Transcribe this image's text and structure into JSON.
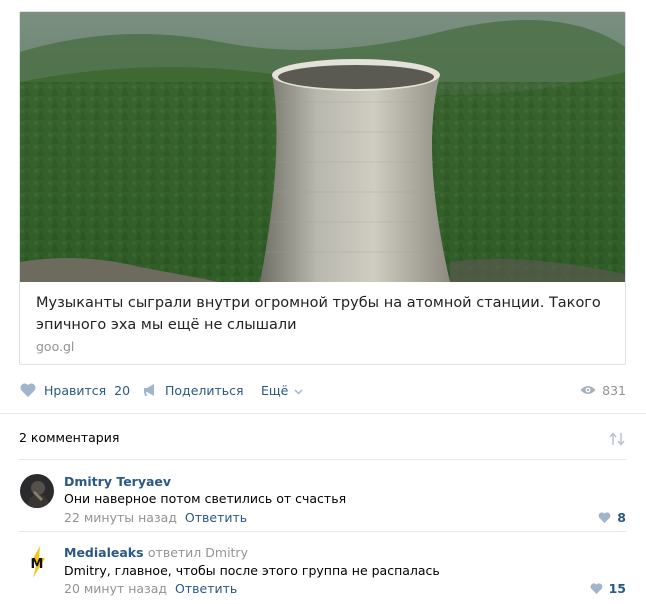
{
  "post": {
    "title": "Музыканты сыграли внутри огромной трубы на атомной станции. Такого эпичного эха мы ещё не слышали",
    "domain": "goo.gl"
  },
  "actions": {
    "like_label": "Нравится",
    "like_count": "20",
    "share_label": "Поделиться",
    "more_label": "Ещё",
    "views": "831"
  },
  "comments_header": "2 комментария",
  "comments": [
    {
      "author": "Dmitry Teryaev",
      "text": "Они наверное потом светились от счастья",
      "time": "22 минуты назад",
      "reply_label": "Ответить",
      "likes": "8"
    },
    {
      "author": "Medialeaks",
      "reply_to": "ответил Dmitry",
      "text": "Dmitry, главное, чтобы после этого группа не распалась",
      "time": "20 минут назад",
      "reply_label": "Ответить",
      "likes": "15",
      "avatar_letter": "M"
    }
  ],
  "colors": {
    "link": "#2a5885",
    "muted": "#939393",
    "icon": "#a0b4cc",
    "border": "#dce1e6"
  }
}
